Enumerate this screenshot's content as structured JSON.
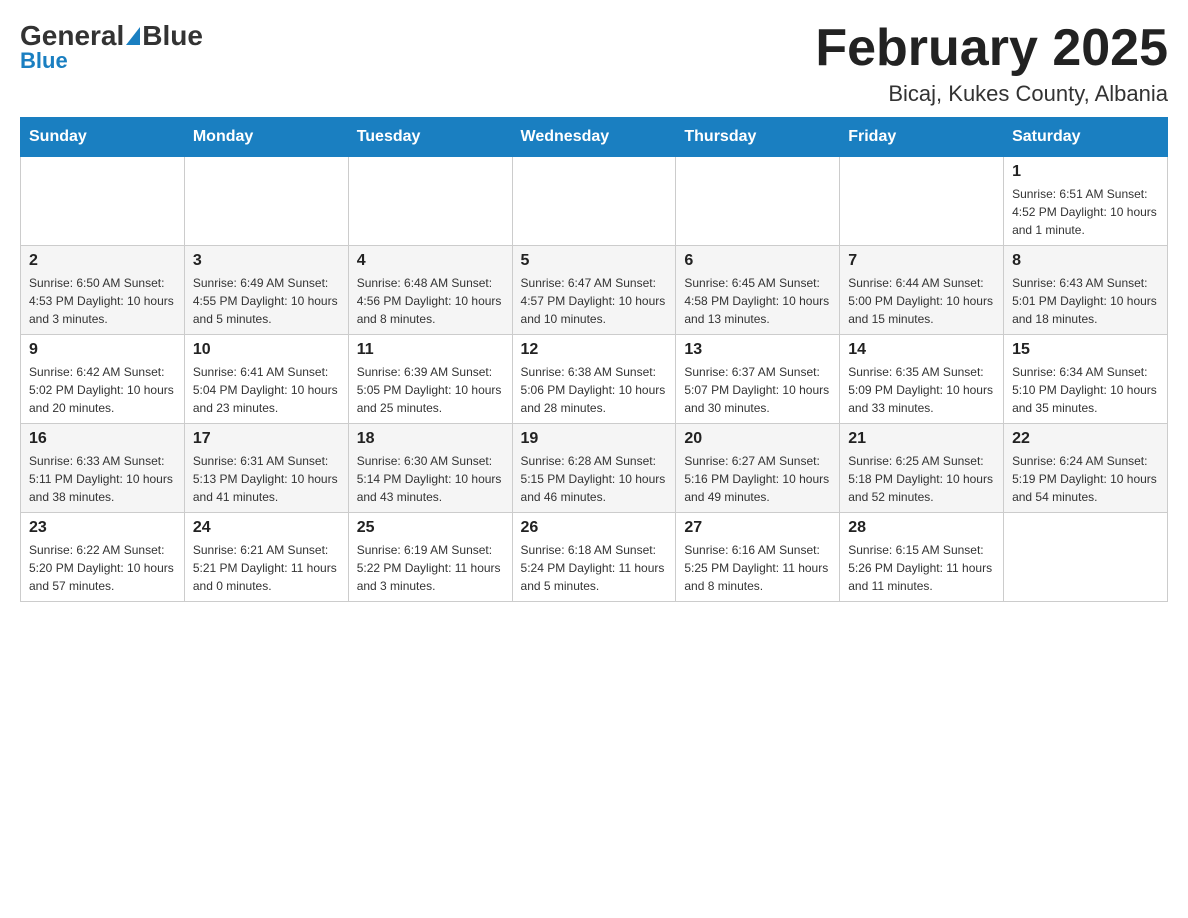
{
  "header": {
    "logo": {
      "general": "General",
      "blue": "Blue"
    },
    "title": "February 2025",
    "location": "Bicaj, Kukes County, Albania"
  },
  "days_of_week": [
    "Sunday",
    "Monday",
    "Tuesday",
    "Wednesday",
    "Thursday",
    "Friday",
    "Saturday"
  ],
  "weeks": [
    {
      "row": 1,
      "cells": [
        {
          "day": "",
          "info": ""
        },
        {
          "day": "",
          "info": ""
        },
        {
          "day": "",
          "info": ""
        },
        {
          "day": "",
          "info": ""
        },
        {
          "day": "",
          "info": ""
        },
        {
          "day": "",
          "info": ""
        },
        {
          "day": "1",
          "info": "Sunrise: 6:51 AM\nSunset: 4:52 PM\nDaylight: 10 hours\nand 1 minute."
        }
      ]
    },
    {
      "row": 2,
      "cells": [
        {
          "day": "2",
          "info": "Sunrise: 6:50 AM\nSunset: 4:53 PM\nDaylight: 10 hours\nand 3 minutes."
        },
        {
          "day": "3",
          "info": "Sunrise: 6:49 AM\nSunset: 4:55 PM\nDaylight: 10 hours\nand 5 minutes."
        },
        {
          "day": "4",
          "info": "Sunrise: 6:48 AM\nSunset: 4:56 PM\nDaylight: 10 hours\nand 8 minutes."
        },
        {
          "day": "5",
          "info": "Sunrise: 6:47 AM\nSunset: 4:57 PM\nDaylight: 10 hours\nand 10 minutes."
        },
        {
          "day": "6",
          "info": "Sunrise: 6:45 AM\nSunset: 4:58 PM\nDaylight: 10 hours\nand 13 minutes."
        },
        {
          "day": "7",
          "info": "Sunrise: 6:44 AM\nSunset: 5:00 PM\nDaylight: 10 hours\nand 15 minutes."
        },
        {
          "day": "8",
          "info": "Sunrise: 6:43 AM\nSunset: 5:01 PM\nDaylight: 10 hours\nand 18 minutes."
        }
      ]
    },
    {
      "row": 3,
      "cells": [
        {
          "day": "9",
          "info": "Sunrise: 6:42 AM\nSunset: 5:02 PM\nDaylight: 10 hours\nand 20 minutes."
        },
        {
          "day": "10",
          "info": "Sunrise: 6:41 AM\nSunset: 5:04 PM\nDaylight: 10 hours\nand 23 minutes."
        },
        {
          "day": "11",
          "info": "Sunrise: 6:39 AM\nSunset: 5:05 PM\nDaylight: 10 hours\nand 25 minutes."
        },
        {
          "day": "12",
          "info": "Sunrise: 6:38 AM\nSunset: 5:06 PM\nDaylight: 10 hours\nand 28 minutes."
        },
        {
          "day": "13",
          "info": "Sunrise: 6:37 AM\nSunset: 5:07 PM\nDaylight: 10 hours\nand 30 minutes."
        },
        {
          "day": "14",
          "info": "Sunrise: 6:35 AM\nSunset: 5:09 PM\nDaylight: 10 hours\nand 33 minutes."
        },
        {
          "day": "15",
          "info": "Sunrise: 6:34 AM\nSunset: 5:10 PM\nDaylight: 10 hours\nand 35 minutes."
        }
      ]
    },
    {
      "row": 4,
      "cells": [
        {
          "day": "16",
          "info": "Sunrise: 6:33 AM\nSunset: 5:11 PM\nDaylight: 10 hours\nand 38 minutes."
        },
        {
          "day": "17",
          "info": "Sunrise: 6:31 AM\nSunset: 5:13 PM\nDaylight: 10 hours\nand 41 minutes."
        },
        {
          "day": "18",
          "info": "Sunrise: 6:30 AM\nSunset: 5:14 PM\nDaylight: 10 hours\nand 43 minutes."
        },
        {
          "day": "19",
          "info": "Sunrise: 6:28 AM\nSunset: 5:15 PM\nDaylight: 10 hours\nand 46 minutes."
        },
        {
          "day": "20",
          "info": "Sunrise: 6:27 AM\nSunset: 5:16 PM\nDaylight: 10 hours\nand 49 minutes."
        },
        {
          "day": "21",
          "info": "Sunrise: 6:25 AM\nSunset: 5:18 PM\nDaylight: 10 hours\nand 52 minutes."
        },
        {
          "day": "22",
          "info": "Sunrise: 6:24 AM\nSunset: 5:19 PM\nDaylight: 10 hours\nand 54 minutes."
        }
      ]
    },
    {
      "row": 5,
      "cells": [
        {
          "day": "23",
          "info": "Sunrise: 6:22 AM\nSunset: 5:20 PM\nDaylight: 10 hours\nand 57 minutes."
        },
        {
          "day": "24",
          "info": "Sunrise: 6:21 AM\nSunset: 5:21 PM\nDaylight: 11 hours\nand 0 minutes."
        },
        {
          "day": "25",
          "info": "Sunrise: 6:19 AM\nSunset: 5:22 PM\nDaylight: 11 hours\nand 3 minutes."
        },
        {
          "day": "26",
          "info": "Sunrise: 6:18 AM\nSunset: 5:24 PM\nDaylight: 11 hours\nand 5 minutes."
        },
        {
          "day": "27",
          "info": "Sunrise: 6:16 AM\nSunset: 5:25 PM\nDaylight: 11 hours\nand 8 minutes."
        },
        {
          "day": "28",
          "info": "Sunrise: 6:15 AM\nSunset: 5:26 PM\nDaylight: 11 hours\nand 11 minutes."
        },
        {
          "day": "",
          "info": ""
        }
      ]
    }
  ]
}
